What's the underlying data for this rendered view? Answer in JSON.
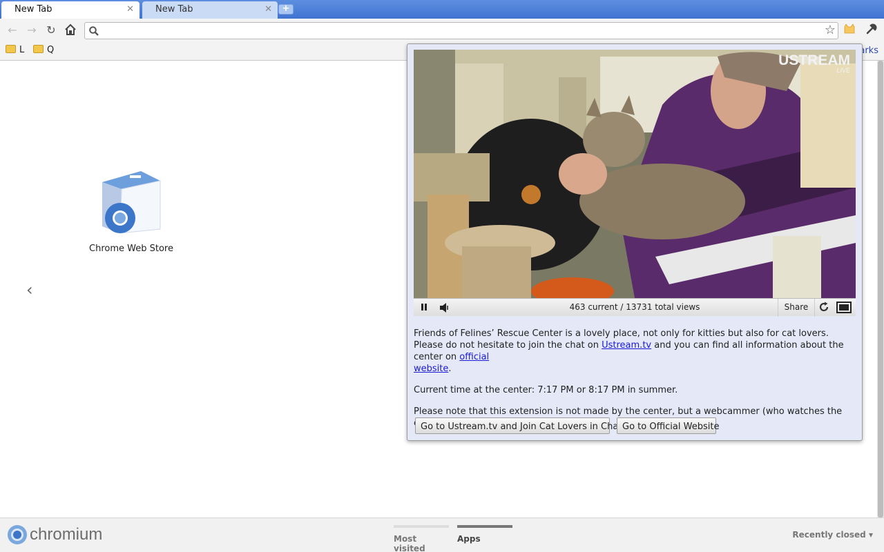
{
  "tabs": [
    {
      "title": "New Tab",
      "active": true
    },
    {
      "title": "New Tab",
      "active": false
    }
  ],
  "toolbar": {
    "omnibox_value": "",
    "icons": [
      "back-arrow",
      "forward-arrow",
      "reload",
      "home",
      "search",
      "star",
      "cat-extension",
      "wrench"
    ]
  },
  "bookmarks": {
    "items": [
      {
        "label": "L"
      },
      {
        "label": "Q"
      }
    ],
    "other_partial": "arks"
  },
  "ntp": {
    "apps": [
      {
        "label": "Chrome Web Store"
      }
    ],
    "prev_arrow": "‹"
  },
  "footer": {
    "brand": "chromium",
    "tabs": [
      "Most visited",
      "Apps"
    ],
    "selected_tab": "Apps",
    "recently_closed": "Recently closed"
  },
  "popup": {
    "video_overlay_brand": "USTREAM",
    "video_overlay_live": "LIVE",
    "player": {
      "view_count": "463 current / 13731 total views",
      "share_label": "Share"
    },
    "paragraph1_before_link1": "Friends of Felines’ Rescue Center is a lovely place, not only for kitties but also for cat lovers. Please do not hesitate to join the chat on ",
    "link1": "Ustream.tv",
    "paragraph1_between": " and you can find all information about the center on ",
    "link2_line1": "official",
    "link2_line2": "website",
    "paragraph1_end": ".",
    "paragraph2": "Current time at the center: 7:17 PM or 8:17 PM in summer.",
    "paragraph3": "Please note that this extension is not made by the center, but a webcammer (who watches the cam).",
    "button_chat": "Go to Ustream.tv and Join Cat Lovers in Chat",
    "button_website": "Go to Official Website"
  },
  "colors": {
    "tabstrip": "#4a7fd8",
    "popup_bg": "#e4e8f7",
    "link": "#1a1ad6"
  }
}
